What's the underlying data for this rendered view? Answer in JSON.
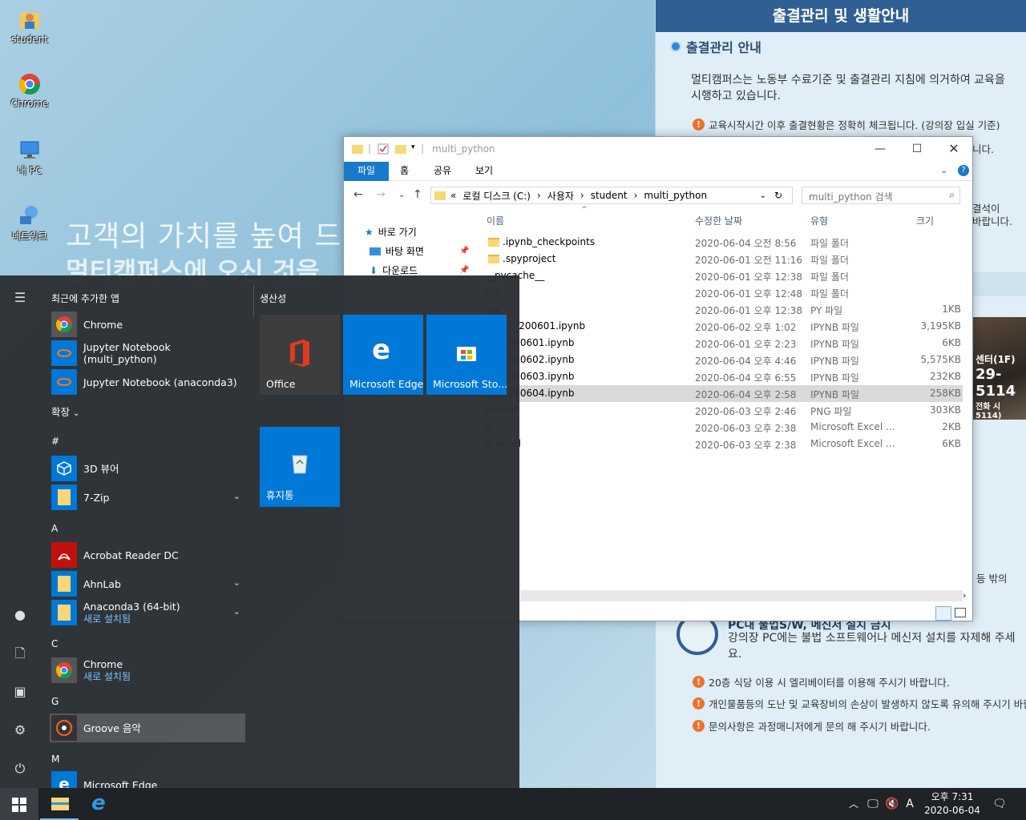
{
  "desktop": {
    "icons": [
      {
        "label": "student",
        "icon": "user-folder-icon"
      },
      {
        "label": "Chrome",
        "icon": "chrome-icon"
      },
      {
        "label": "내 PC",
        "icon": "computer-icon"
      },
      {
        "label": "네트워크",
        "icon": "network-icon"
      }
    ],
    "slogan_line1": "고객의 가치를 높여 드",
    "slogan_line2": "멀티캠퍼스에 오신 것을"
  },
  "info_panel": {
    "title": "출결관리 및 생활안내",
    "subtitle": "출결관리 안내",
    "paragraph": "멀티캠퍼스는 노동부 수료기준 및 출결관리 지침에 의거하여 교육을 시행하고 있습니다.",
    "warn_top": "교육시작시간 이후 출결현황은 정확히 체크됩니다. (강의장 입실 기준)",
    "side_note1": "니다.",
    "side_note2": "결석이",
    "side_note3": "바랍니다.",
    "photo_line1": "센터(1F)",
    "photo_line2": "29-5114",
    "photo_line3": "전화 시 5114)",
    "side_note4": "등 밖의",
    "pc_title": "PC내 불법S/W, 메신저 설치 금지",
    "pc_desc": "강의장 PC에는 불법 소프트웨어나 메신저 설치를 자제해 주세요.",
    "warns": [
      "20층 식당 이용 시 엘리베이터를 이용해 주시기 바랍니다.",
      "개인물품등의 도난 및 교육장비의 손상이 발생하지 않도록 유의해 주시기 바랍니",
      "문의사항은 과정매니저에게 문의 해 주시기 바랍니다."
    ]
  },
  "start_menu": {
    "recent_heading": "최근에 추가한 앱",
    "recent_apps": [
      "Chrome",
      "Jupyter Notebook (multi_python)",
      "Jupyter Notebook (anaconda3)"
    ],
    "expand_label": "확장",
    "letter_hash": "#",
    "letter_a": "A",
    "letter_c": "C",
    "letter_g": "G",
    "letter_m": "M",
    "apps": {
      "viewer3d": "3D 뷰어",
      "sevenzip": "7-Zip",
      "acrobat": "Acrobat Reader DC",
      "ahnlab": "AhnLab",
      "anaconda": "Anaconda3 (64-bit)",
      "anaconda_sub": "새로 설치됨",
      "chrome": "Chrome",
      "chrome_sub": "새로 설치됨",
      "groove": "Groove 음악",
      "edge": "Microsoft Edge"
    },
    "tiles_heading": "생산성",
    "tiles": {
      "office": "Office",
      "edge": "Microsoft Edge",
      "store": "Microsoft Sto...",
      "recycle": "휴지통"
    }
  },
  "explorer": {
    "title": "multi_python",
    "ribbon_tabs": [
      "파일",
      "홈",
      "공유",
      "보기"
    ],
    "address": [
      "«",
      "로컬 디스크 (C:)",
      "›",
      "사용자",
      "›",
      "student",
      "›",
      "multi_python"
    ],
    "search_placeholder": "multi_python 검색",
    "nav": [
      "바로 가기",
      "바탕 화면",
      "다운로드"
    ],
    "columns": {
      "name": "이름",
      "date": "수정한 날짜",
      "type": "유형",
      "size": "크기"
    },
    "files": [
      {
        "name": ".ipynb_checkpoints",
        "date": "2020-06-04 오전 8:56",
        "type": "파일 폴더",
        "size": ""
      },
      {
        "name": ".spyproject",
        "date": "2020-06-01 오전 11:16",
        "type": "파일 폴더",
        "size": ""
      },
      {
        "name": "__pycache__",
        "date": "2020-06-01 오후 12:38",
        "type": "파일 폴더",
        "size": ""
      },
      {
        "name": "alc",
        "date": "2020-06-01 오후 12:48",
        "type": "파일 폴더",
        "size": ""
      },
      {
        "name": ".py",
        "date": "2020-06-01 오후 12:38",
        "type": "PY 파일",
        "size": "1KB"
      },
      {
        "name": "on6_2_200601.ipynb",
        "date": "2020-06-02 오후 1:02",
        "type": "IPYNB 파일",
        "size": "3,195KB"
      },
      {
        "name": "on6_200601.ipynb",
        "date": "2020-06-01 오후 2:23",
        "type": "IPYNB 파일",
        "size": "6KB"
      },
      {
        "name": "on7_200602.ipynb",
        "date": "2020-06-04 오후 4:46",
        "type": "IPYNB 파일",
        "size": "5,575KB"
      },
      {
        "name": "on8_200603.ipynb",
        "date": "2020-06-04 오후 6:55",
        "type": "IPYNB 파일",
        "size": "232KB"
      },
      {
        "name": "on9_200604.ipynb",
        "date": "2020-06-04 오후 2:58",
        "type": "IPYNB 파일",
        "size": "258KB"
      },
      {
        "name": "enshot",
        "date": "2020-06-03 오후 2:46",
        "type": "PNG 파일",
        "size": "303KB"
      },
      {
        "name": "p",
        "date": "2020-06-03 오후 2:38",
        "type": "Microsoft Excel ...",
        "size": "2KB"
      },
      {
        "name": "p_excel",
        "date": "2020-06-03 오후 2:38",
        "type": "Microsoft Excel ...",
        "size": "6KB"
      }
    ]
  },
  "taskbar": {
    "time": "오후 7:31",
    "date": "2020-06-04",
    "ime": "A"
  }
}
